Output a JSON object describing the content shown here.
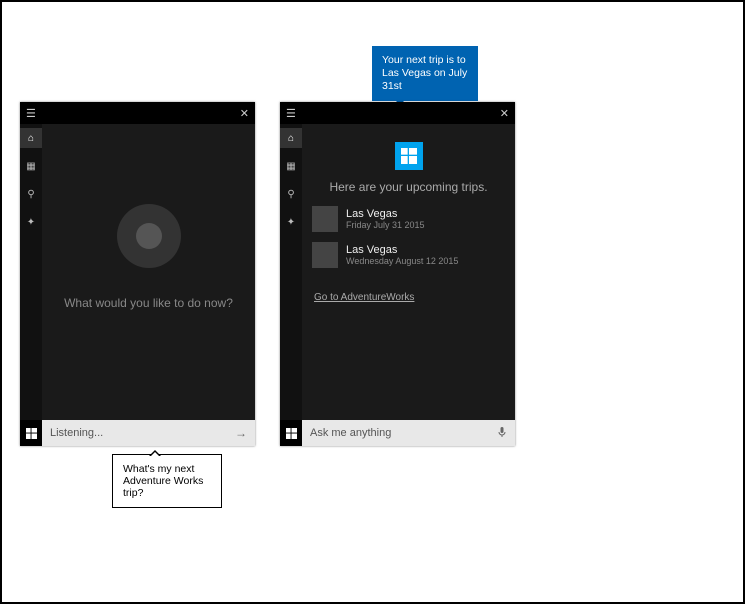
{
  "tooltip": {
    "text": "Your next trip is to Las Vegas on July 31st"
  },
  "speech": {
    "text": "What's my next Adventure Works trip?"
  },
  "left": {
    "prompt": "What would you like to do now?",
    "input_text": "Listening..."
  },
  "right": {
    "heading": "Here are your upcoming trips.",
    "trips": [
      {
        "dest": "Las Vegas",
        "date": "Friday July 31 2015"
      },
      {
        "dest": "Las Vegas",
        "date": "Wednesday August 12 2015"
      }
    ],
    "link": "Go to AdventureWorks",
    "input_placeholder": "Ask me anything"
  }
}
